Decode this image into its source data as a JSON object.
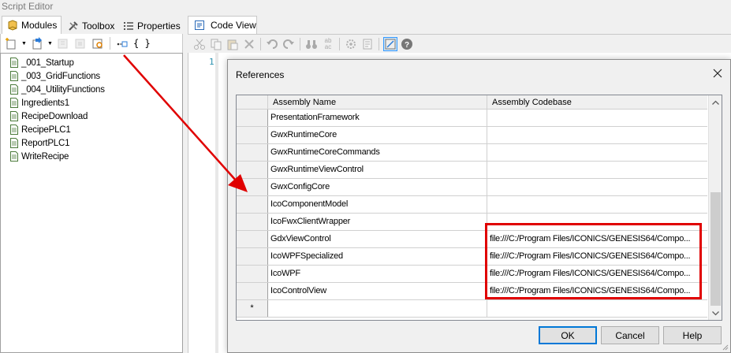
{
  "window": {
    "title": "Script Editor"
  },
  "left_tabs": [
    {
      "label": "Modules",
      "icon": "modules-icon",
      "active": true
    },
    {
      "label": "Toolbox",
      "icon": "toolbox-icon",
      "active": false
    },
    {
      "label": "Properties",
      "icon": "properties-icon",
      "active": false
    }
  ],
  "left_toolbar": {
    "braces_label": "{ }"
  },
  "modules": [
    "_001_Startup",
    "_003_GridFunctions",
    "_004_UtilityFunctions",
    "Ingredients1",
    "RecipeDownload",
    "RecipePLC1",
    "ReportPLC1",
    "WriteRecipe"
  ],
  "code_view": {
    "tab_label": "Code View",
    "line_number": "1"
  },
  "dialog": {
    "title": "References",
    "columns": [
      "Assembly Name",
      "Assembly Codebase"
    ],
    "rows": [
      {
        "name": "PresentationFramework",
        "codebase": ""
      },
      {
        "name": "GwxRuntimeCore",
        "codebase": ""
      },
      {
        "name": "GwxRuntimeCoreCommands",
        "codebase": ""
      },
      {
        "name": "GwxRuntimeViewControl",
        "codebase": ""
      },
      {
        "name": "GwxConfigCore",
        "codebase": ""
      },
      {
        "name": "IcoComponentModel",
        "codebase": ""
      },
      {
        "name": "IcoFwxClientWrapper",
        "codebase": ""
      },
      {
        "name": "GdxViewControl",
        "codebase": "file:///C:/Program Files/ICONICS/GENESIS64/Compo..."
      },
      {
        "name": "IcoWPFSpecialized",
        "codebase": "file:///C:/Program Files/ICONICS/GENESIS64/Compo..."
      },
      {
        "name": "IcoWPF",
        "codebase": "file:///C:/Program Files/ICONICS/GENESIS64/Compo..."
      },
      {
        "name": "IcoControlView",
        "codebase": "file:///C:/Program Files/ICONICS/GENESIS64/Compo..."
      }
    ],
    "new_row_marker": "*",
    "buttons": {
      "ok": "OK",
      "cancel": "Cancel",
      "help": "Help"
    }
  },
  "annotation_colors": {
    "arrow": "#e00000",
    "highlight_box": "#e00000"
  }
}
